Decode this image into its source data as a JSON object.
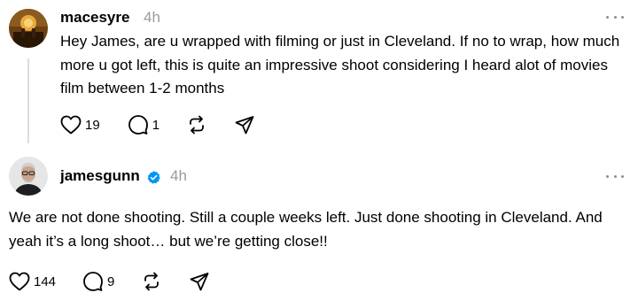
{
  "posts": [
    {
      "username": "macesyre",
      "time": "4h",
      "text": "Hey James, are u wrapped with filming or just in Cleveland. If no to wrap, how much more u got left, this is quite an impressive shoot considering I heard alot of movies film between 1-2 months",
      "likes": "19",
      "comments": "1",
      "icons": [
        "heart-icon",
        "comment-icon",
        "repost-icon",
        "share-icon"
      ]
    },
    {
      "username": "jamesgunn",
      "time": "4h",
      "verified": true,
      "text": "We are not done shooting. Still a couple weeks left. Just done shooting in Cleveland. And yeah it’s a long shoot… but we’re getting close!!",
      "likes": "144",
      "comments": "9",
      "icons": [
        "heart-icon",
        "comment-icon",
        "repost-icon",
        "share-icon"
      ]
    }
  ],
  "colors": {
    "verified": "#0095f6",
    "muted": "#9a9a9a",
    "thread_line": "#dcdcdc"
  }
}
